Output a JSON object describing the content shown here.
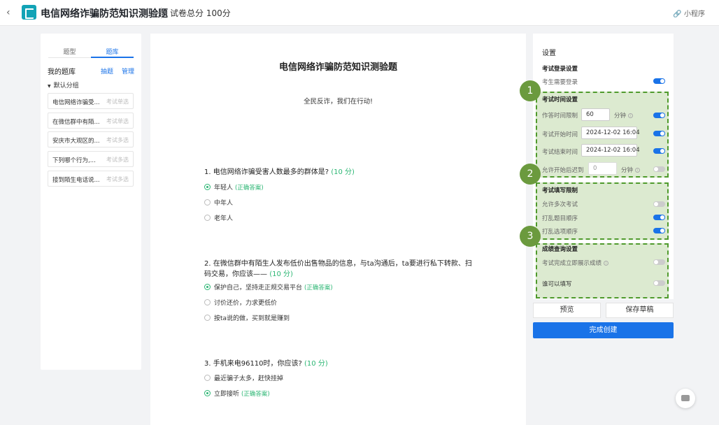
{
  "topbar": {
    "back_icon": "chevron-left-icon",
    "app_icon": "quiz-icon",
    "title": "电信网络诈骗防范知识测验题",
    "total_score": "试卷总分 100分",
    "mini_program": "小程序",
    "mini_program_icon": "link-icon"
  },
  "left_panel": {
    "tabs": [
      "题型",
      "题库"
    ],
    "active_tab": "题库",
    "my_bank": "我的题库",
    "draw_label": "抽题",
    "manage_label": "管理",
    "group_label": "默认分组",
    "items": [
      {
        "title": "电信网络诈骗受...",
        "type": "考试单选"
      },
      {
        "title": "在微信群中有陌...",
        "type": "考试单选"
      },
      {
        "title": "安庆市大观区的...",
        "type": "考试多选"
      },
      {
        "title": "下列哪个行为,...",
        "type": "考试多选"
      },
      {
        "title": "接到陌生电话说...",
        "type": "考试多选"
      }
    ]
  },
  "paper": {
    "title": "电信网络诈骗防范知识测验题",
    "intro": "全民反诈，我们在行动!",
    "correct_label": "(正确答案)",
    "questions": [
      {
        "text": "1.  电信网络诈骗受害人数最多的群体是?",
        "score": "(10 分)",
        "options": [
          {
            "text": "年轻人",
            "correct": true
          },
          {
            "text": "中年人",
            "correct": false
          },
          {
            "text": "老年人",
            "correct": false
          }
        ]
      },
      {
        "text": "2.  在微信群中有陌生人发布低价出售物品的信息，与ta沟通后，ta要进行私下转款、扫码交易，你应该——",
        "score": "(10 分)",
        "options": [
          {
            "text": "保护自己，坚持走正规交易平台",
            "correct": true
          },
          {
            "text": "讨价还价，力求更低价",
            "correct": false
          },
          {
            "text": "按ta说的做，买到就是赚到",
            "correct": false
          }
        ]
      },
      {
        "text": "3.  手机来电96110时，你应该?",
        "score": "(10 分)",
        "options": [
          {
            "text": "最近骗子太多，赶快挂掉",
            "correct": false
          },
          {
            "text": "立即接听",
            "correct": true
          }
        ]
      }
    ]
  },
  "settings": {
    "title": "设置",
    "login_section": "考试登录设置",
    "login_required": "考生需要登录",
    "time_section": "考试时间设置",
    "time_limit_label": "作答时间限制",
    "time_limit_value": "60",
    "minutes": "分钟",
    "start_label": "考试开始时间",
    "start_value": "2024-12-02 16:04",
    "end_label": "考试结束时间",
    "end_value": "2024-12-02 16:04",
    "late_label": "允许开始后迟到",
    "late_value": "0",
    "fill_section": "考试填写限制",
    "multi_label": "允许多次考试",
    "shuffle_q_label": "打乱题目顺序",
    "shuffle_opt_label": "打乱选项顺序",
    "result_section": "成绩查询设置",
    "show_result_label": "考试完成立即展示成绩",
    "who_label": "谁可以填写",
    "badges": [
      "1",
      "2",
      "3"
    ]
  },
  "actions": {
    "preview": "预览",
    "save_draft": "保存草稿",
    "finish": "完成创建"
  },
  "colors": {
    "primary": "#1a73e8",
    "correct": "#2bb673",
    "highlight": "#4f9a2c",
    "badge": "#6b9a3e"
  }
}
